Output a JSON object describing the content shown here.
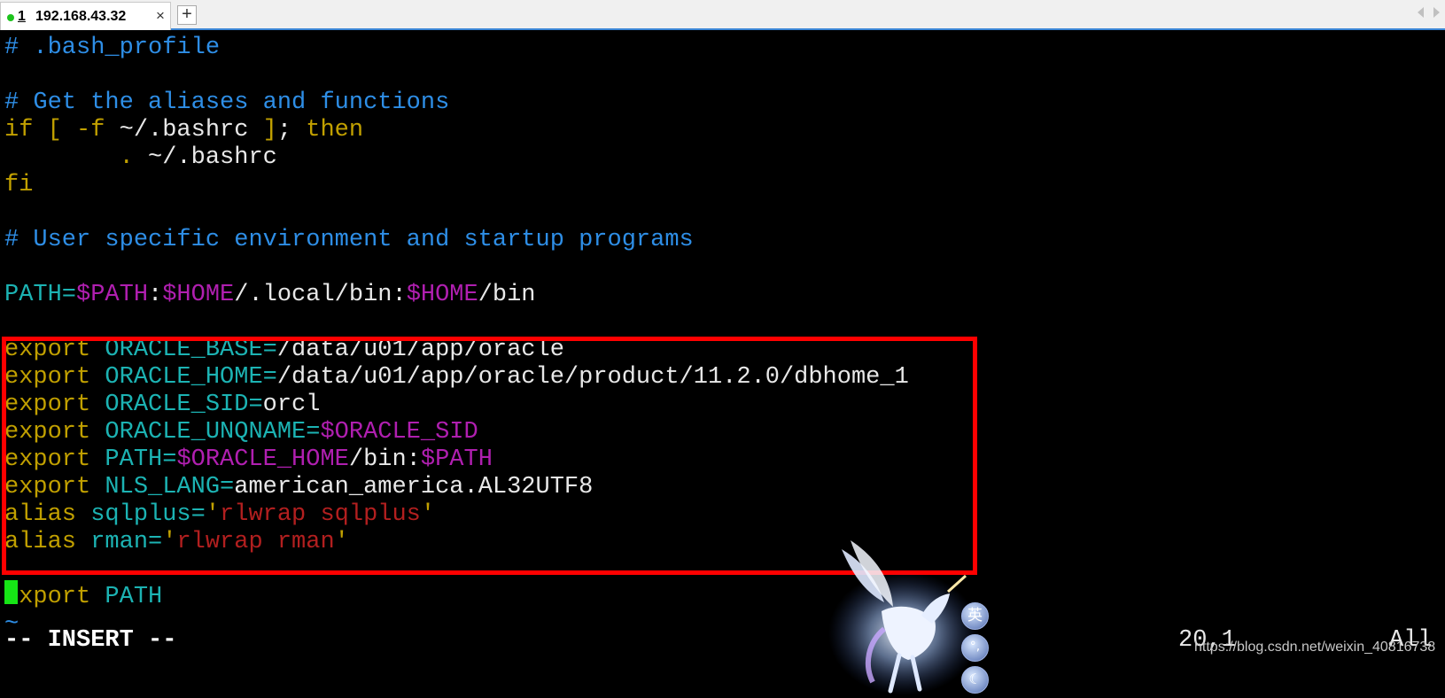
{
  "tabbar": {
    "active_tab": {
      "number": "1",
      "title": "192.168.43.32",
      "close_glyph": "×",
      "status_color": "#1dc31d"
    },
    "new_tab_glyph": "+"
  },
  "editor": {
    "lines": [
      {
        "tokens": [
          {
            "t": "# .bash_profile",
            "c": "comment"
          }
        ]
      },
      {
        "tokens": []
      },
      {
        "tokens": [
          {
            "t": "# Get the aliases and functions",
            "c": "comment"
          }
        ]
      },
      {
        "tokens": [
          {
            "t": "if",
            "c": "kw"
          },
          {
            "t": " ",
            "c": "plain"
          },
          {
            "t": "[",
            "c": "kw"
          },
          {
            "t": " ",
            "c": "plain"
          },
          {
            "t": "-f",
            "c": "kw"
          },
          {
            "t": " ~/.bashrc ",
            "c": "plain"
          },
          {
            "t": "]",
            "c": "kw"
          },
          {
            "t": "; ",
            "c": "plain"
          },
          {
            "t": "then",
            "c": "kw"
          }
        ]
      },
      {
        "tokens": [
          {
            "t": "        ",
            "c": "plain"
          },
          {
            "t": ".",
            "c": "kw"
          },
          {
            "t": " ~/.bashrc",
            "c": "plain"
          }
        ]
      },
      {
        "tokens": [
          {
            "t": "fi",
            "c": "kw"
          }
        ]
      },
      {
        "tokens": []
      },
      {
        "tokens": [
          {
            "t": "# User specific environment and startup programs",
            "c": "comment"
          }
        ]
      },
      {
        "tokens": []
      },
      {
        "tokens": [
          {
            "t": "PATH=",
            "c": "id"
          },
          {
            "t": "$PATH",
            "c": "var"
          },
          {
            "t": ":",
            "c": "plain"
          },
          {
            "t": "$HOME",
            "c": "var"
          },
          {
            "t": "/.local/bin:",
            "c": "plain"
          },
          {
            "t": "$HOME",
            "c": "var"
          },
          {
            "t": "/bin",
            "c": "plain"
          }
        ]
      },
      {
        "tokens": []
      },
      {
        "tokens": [
          {
            "t": "export",
            "c": "kw"
          },
          {
            "t": " ",
            "c": "plain"
          },
          {
            "t": "ORACLE_BASE=",
            "c": "id"
          },
          {
            "t": "/data/u01/app/oracle",
            "c": "plain"
          }
        ]
      },
      {
        "tokens": [
          {
            "t": "export",
            "c": "kw"
          },
          {
            "t": " ",
            "c": "plain"
          },
          {
            "t": "ORACLE_HOME=",
            "c": "id"
          },
          {
            "t": "/data/u01/app/oracle/product/11.2.0/dbhome_1",
            "c": "plain"
          }
        ]
      },
      {
        "tokens": [
          {
            "t": "export",
            "c": "kw"
          },
          {
            "t": " ",
            "c": "plain"
          },
          {
            "t": "ORACLE_SID=",
            "c": "id"
          },
          {
            "t": "orcl",
            "c": "plain"
          }
        ]
      },
      {
        "tokens": [
          {
            "t": "export",
            "c": "kw"
          },
          {
            "t": " ",
            "c": "plain"
          },
          {
            "t": "ORACLE_UNQNAME=",
            "c": "id"
          },
          {
            "t": "$ORACLE_SID",
            "c": "var"
          }
        ]
      },
      {
        "tokens": [
          {
            "t": "export",
            "c": "kw"
          },
          {
            "t": " ",
            "c": "plain"
          },
          {
            "t": "PATH=",
            "c": "id"
          },
          {
            "t": "$ORACLE_HOME",
            "c": "var"
          },
          {
            "t": "/bin:",
            "c": "plain"
          },
          {
            "t": "$PATH",
            "c": "var"
          }
        ]
      },
      {
        "tokens": [
          {
            "t": "export",
            "c": "kw"
          },
          {
            "t": " ",
            "c": "plain"
          },
          {
            "t": "NLS_LANG=",
            "c": "id"
          },
          {
            "t": "american_america.AL32UTF8",
            "c": "plain"
          }
        ]
      },
      {
        "tokens": [
          {
            "t": "alias",
            "c": "kw"
          },
          {
            "t": " ",
            "c": "plain"
          },
          {
            "t": "sqlplus=",
            "c": "id"
          },
          {
            "t": "'",
            "c": "kw"
          },
          {
            "t": "rlwrap sqlplus",
            "c": "str"
          },
          {
            "t": "'",
            "c": "kw"
          }
        ]
      },
      {
        "tokens": [
          {
            "t": "alias",
            "c": "kw"
          },
          {
            "t": " ",
            "c": "plain"
          },
          {
            "t": "rman=",
            "c": "id"
          },
          {
            "t": "'",
            "c": "kw"
          },
          {
            "t": "rlwrap rman",
            "c": "str"
          },
          {
            "t": "'",
            "c": "kw"
          }
        ]
      },
      {
        "tokens": []
      },
      {
        "tokens": [
          {
            "t": "export",
            "c": "kw"
          },
          {
            "t": " ",
            "c": "plain"
          },
          {
            "t": "PATH",
            "c": "id"
          }
        ]
      },
      {
        "tokens": [
          {
            "t": "~",
            "c": "tilde"
          }
        ]
      }
    ],
    "cursor_color": "#16e516"
  },
  "statusline": {
    "mode": "-- INSERT --",
    "position": "20,1",
    "scroll": "All"
  },
  "watermark": "https://blog.csdn.net/weixin_40816738",
  "ime_toolbar": {
    "lang_glyph": "英",
    "punct_glyph": "°,",
    "moon_glyph": "☾"
  },
  "colors": {
    "highlight_box": "#ff0000",
    "comment": "#2e8ee6",
    "keyword": "#c1a000",
    "identifier": "#1cb3b3",
    "variable": "#b01fb0",
    "string": "#b21f1f",
    "tab_underline": "#3b86d6"
  }
}
